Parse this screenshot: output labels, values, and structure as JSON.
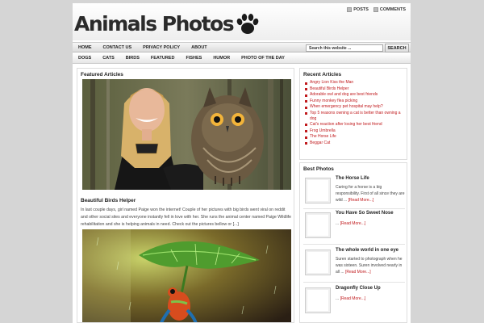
{
  "header": {
    "logo_text": "Animals Photos",
    "feeds": [
      {
        "label": "POSTS"
      },
      {
        "label": "COMMENTS"
      }
    ]
  },
  "nav_primary": {
    "items": [
      "HOME",
      "CONTACT US",
      "PRIVACY POLICY",
      "ABOUT"
    ],
    "search_placeholder": "Search this website ...",
    "search_button": "SEARCH"
  },
  "nav_secondary": {
    "items": [
      "DOGS",
      "CATS",
      "BIRDS",
      "FEATURED",
      "FISHES",
      "HUMOR",
      "PHOTO OF THE DAY"
    ]
  },
  "main": {
    "section_title": "Featured Articles",
    "posts": [
      {
        "title": "Beautiful Birds Helper",
        "excerpt": "In last couple days, girl named Paige won the internet! Couple of her pictures with big birds went viral on reddit and other social sites and everyone instantly fell in love with her. She runs the animal center named Paige Wildlife rehabilitation and she is helping animals in need. Check out the pictures bellow or [...]"
      }
    ]
  },
  "sidebar": {
    "recent_title": "Recent Articles",
    "recent_items": [
      "Angry Lion Kiss the Man",
      "Beautiful Birds Helper",
      "Adorable owl and dog are best friends",
      "Funny monkey flea picking",
      "When emergency pet hospital may help?",
      "Top 5 reasons owning a cat is better than owning a dog",
      "Cat's reaction after losing her best friend",
      "Frog Umbrella",
      "The Horse Life",
      "Beggar Cat"
    ],
    "best_title": "Best Photos",
    "best_items": [
      {
        "title": "The Horse Life",
        "text": "Caring for a horse is a big responsibility. First of all since they are wild ...",
        "more": "[Read More...]"
      },
      {
        "title": "You Have So Sweet Nose",
        "text": "...",
        "more": "[Read More...]"
      },
      {
        "title": "The whole world in one eye",
        "text": "Suren started to photograph when he was sixteen. Suren involved nearly in all ...",
        "more": "[Read More...]"
      },
      {
        "title": "Dragonfly Close Up",
        "text": "...",
        "more": "[Read More...]"
      }
    ]
  },
  "colors": {
    "link_red": "#c0191c",
    "page_bg": "#d5d5d5",
    "text_dark": "#222222"
  },
  "icons": [
    "paw-icon",
    "rss-icon"
  ]
}
